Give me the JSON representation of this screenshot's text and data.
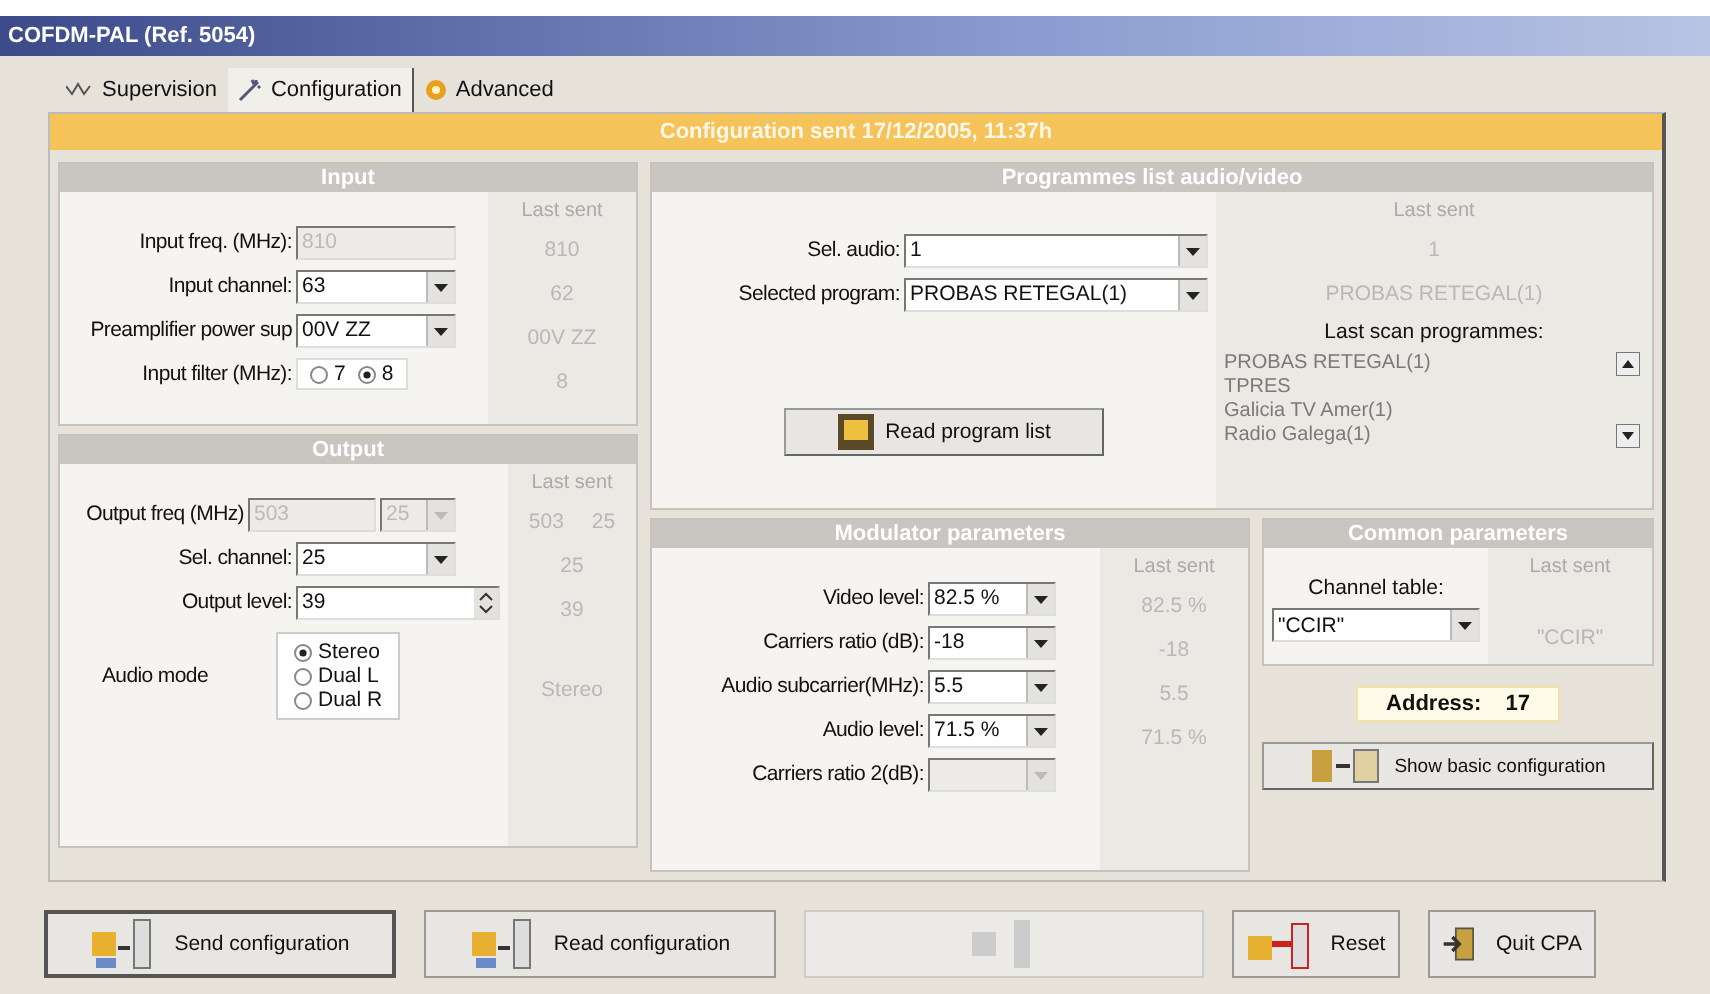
{
  "window": {
    "title": "COFDM-PAL (Ref. 5054)"
  },
  "tabs": [
    {
      "label": "Supervision",
      "kind": "wave",
      "selected": false
    },
    {
      "label": "Configuration",
      "kind": "wand",
      "selected": true
    },
    {
      "label": "Advanced",
      "kind": "gear",
      "selected": false
    }
  ],
  "banner": "Configuration sent 17/12/2005, 11:37h",
  "input": {
    "title": "Input",
    "last_sent_label": "Last sent",
    "rows": [
      {
        "label": "Input freq. (MHz):",
        "kind": "text",
        "value": "810",
        "disabled": true,
        "last": "810"
      },
      {
        "label": "Input channel:",
        "kind": "select",
        "value": "63",
        "disabled": false,
        "last": "62"
      },
      {
        "label": "Preamplifier power sup",
        "kind": "select",
        "value": "00V ZZ",
        "disabled": false,
        "last": "00V ZZ"
      },
      {
        "label": "Input filter (MHz):",
        "kind": "radio",
        "disabled": false,
        "options": [
          {
            "label": "7",
            "selected": false
          },
          {
            "label": "8",
            "selected": true
          }
        ],
        "last": "8"
      }
    ]
  },
  "output": {
    "title": "Output",
    "last_sent_label": "Last sent",
    "rows": [
      {
        "label": "Output freq (MHz)",
        "kind": "freq",
        "value": "503",
        "channel": "25",
        "disabled": true,
        "last": "503",
        "last_channel": "25"
      },
      {
        "label": "Sel. channel:",
        "kind": "select",
        "value": "25",
        "disabled": false,
        "last": "25"
      },
      {
        "label": "Output level:",
        "kind": "spin",
        "value": "39",
        "disabled": false,
        "last": "39"
      },
      {
        "label": "Audio mode",
        "kind": "radio-column",
        "disabled": false,
        "options": [
          {
            "label": "Stereo",
            "selected": true
          },
          {
            "label": "Dual L",
            "selected": false
          },
          {
            "label": "Dual R",
            "selected": false
          }
        ],
        "last": "Stereo"
      }
    ]
  },
  "programmes": {
    "title": "Programmes list audio/video",
    "last_sent_label": "Last sent",
    "rows": [
      {
        "label": "Sel. audio:",
        "value": "1",
        "last": "1"
      },
      {
        "label": "Selected program:",
        "value": "PROBAS RETEGAL(1)",
        "last": "PROBAS RETEGAL(1)"
      }
    ],
    "read_button": "Read program list",
    "scan_label": "Last scan programmes:",
    "scan_list": [
      "PROBAS RETEGAL(1)",
      "TPRES",
      "Galicia TV Amer(1)",
      "Radio Galega(1)"
    ]
  },
  "modulator": {
    "title": "Modulator parameters",
    "last_sent_label": "Last sent",
    "rows": [
      {
        "label": "Video level:",
        "value": "82.5 %",
        "disabled": false,
        "last": "82.5 %"
      },
      {
        "label": "Carriers ratio (dB):",
        "value": "-18",
        "disabled": false,
        "last": "-18"
      },
      {
        "label": "Audio subcarrier(MHz):",
        "value": "5.5",
        "disabled": false,
        "last": "5.5"
      },
      {
        "label": "Audio level:",
        "value": "71.5 %",
        "disabled": false,
        "last": "71.5 %"
      },
      {
        "label": "Carriers ratio 2(dB):",
        "disabled": true
      }
    ]
  },
  "common": {
    "title": "Common parameters",
    "last_sent_label": "Last sent",
    "channel_table_label": "Channel table:",
    "channel_table": "\"CCIR\"",
    "last": "\"CCIR\"",
    "address_label": "Address:",
    "address": "17",
    "basic_button": "Show basic configuration"
  },
  "footer": [
    {
      "label": "Send configuration",
      "kind": "send",
      "disabled": false,
      "focused": true
    },
    {
      "label": "Read configuration",
      "kind": "read",
      "disabled": false,
      "focused": false
    },
    {
      "kind": "remote",
      "disabled": true,
      "focused": false
    },
    {
      "label": "Reset",
      "kind": "reset",
      "disabled": false,
      "focused": false
    },
    {
      "label": "Quit CPA",
      "kind": "quit",
      "disabled": false,
      "focused": false
    }
  ]
}
